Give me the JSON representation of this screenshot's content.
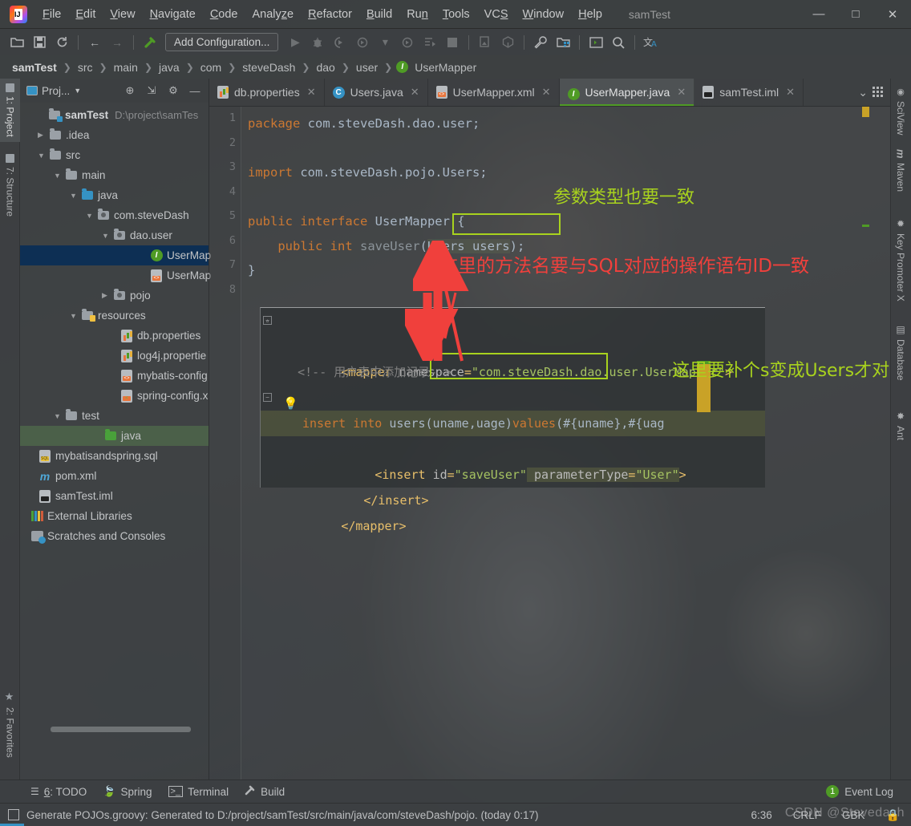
{
  "window": {
    "title": "samTest",
    "minimize": "—",
    "maximize": "□",
    "close": "✕"
  },
  "menubar": {
    "items": [
      {
        "label": "File",
        "mnemonic": "F"
      },
      {
        "label": "Edit",
        "mnemonic": "E"
      },
      {
        "label": "View",
        "mnemonic": "V"
      },
      {
        "label": "Navigate",
        "mnemonic": "N"
      },
      {
        "label": "Code",
        "mnemonic": "C"
      },
      {
        "label": "Analyze",
        "mnemonic": "z"
      },
      {
        "label": "Refactor",
        "mnemonic": "R"
      },
      {
        "label": "Build",
        "mnemonic": "B"
      },
      {
        "label": "Run",
        "mnemonic": "n"
      },
      {
        "label": "Tools",
        "mnemonic": "T"
      },
      {
        "label": "VCS",
        "mnemonic": "S"
      },
      {
        "label": "Window",
        "mnemonic": "W"
      },
      {
        "label": "Help",
        "mnemonic": "H"
      }
    ]
  },
  "toolbar": {
    "run_config_label": "Add Configuration...",
    "icons": [
      "open-folder-icon",
      "save-all-icon",
      "sync-icon",
      "back-icon",
      "forward-icon",
      "build-hammer-icon",
      "run-icon",
      "debug-icon",
      "run-with-coverage-icon",
      "profile-icon",
      "profile-dropdown-icon",
      "rerun-icon",
      "run-console-icon",
      "stop-icon",
      "update-project-icon",
      "commit-icon",
      "settings-wrench-icon",
      "project-structure-icon",
      "terminal-icon",
      "search-everywhere-icon",
      "translate-icon"
    ]
  },
  "breadcrumb": {
    "items": [
      "samTest",
      "src",
      "main",
      "java",
      "com",
      "steveDash",
      "dao",
      "user"
    ],
    "leaf": "UserMapper",
    "leaf_icon": "I"
  },
  "left_tool_strip": {
    "tabs": [
      {
        "label": "1: Project",
        "active": true,
        "icon": "project-folder-icon"
      },
      {
        "label": "7: Structure",
        "active": false,
        "icon": "structure-icon"
      },
      {
        "label": "2: Favorites",
        "active": false,
        "icon": "star-icon"
      }
    ]
  },
  "right_tool_strip": {
    "tabs": [
      {
        "label": "SciView",
        "icon": "sciview-icon"
      },
      {
        "label": "Maven",
        "icon": "maven-m-icon"
      },
      {
        "label": "Key Promoter X",
        "icon": "key-promoter-icon"
      },
      {
        "label": "Database",
        "icon": "database-icon"
      },
      {
        "label": "Ant",
        "icon": "ant-icon"
      }
    ]
  },
  "project_panel": {
    "title": "Proj...",
    "header_icons": [
      "target-locate-icon",
      "collapse-all-icon",
      "gear-icon",
      "hide-icon"
    ],
    "tree": [
      {
        "label": "samTest",
        "path": "D:\\project\\samTes",
        "depth": 0,
        "arrow": "",
        "icon": "module-folder-icon",
        "bold": true,
        "state": "none"
      },
      {
        "label": ".idea",
        "depth": 1,
        "arrow": "▶",
        "icon": "folder-icon",
        "state": "none"
      },
      {
        "label": "src",
        "depth": 1,
        "arrow": "▼",
        "icon": "folder-icon",
        "state": "none"
      },
      {
        "label": "main",
        "depth": 2,
        "arrow": "▼",
        "icon": "folder-icon",
        "state": "none"
      },
      {
        "label": "java",
        "depth": 3,
        "arrow": "▼",
        "icon": "source-root-folder-icon",
        "state": "none"
      },
      {
        "label": "com.steveDash",
        "depth": 4,
        "arrow": "▼",
        "icon": "package-icon",
        "state": "none"
      },
      {
        "label": "dao.user",
        "depth": 5,
        "arrow": "▼",
        "icon": "package-icon",
        "state": "none"
      },
      {
        "label": "UserMap",
        "depth": 6,
        "arrow": "",
        "icon": "interface-icon",
        "state": "selected-blue"
      },
      {
        "label": "UserMap",
        "depth": 6,
        "arrow": "",
        "icon": "xml-file-icon",
        "state": "none"
      },
      {
        "label": "pojo",
        "depth": 4,
        "arrow": "▶",
        "icon": "package-icon",
        "state": "none"
      },
      {
        "label": "resources",
        "depth": 3,
        "arrow": "▼",
        "icon": "resources-folder-icon",
        "state": "none"
      },
      {
        "label": "db.properties",
        "depth": 4,
        "arrow": "",
        "icon": "properties-file-icon",
        "state": "none"
      },
      {
        "label": "log4j.propertie",
        "depth": 4,
        "arrow": "",
        "icon": "properties-file-icon",
        "state": "none"
      },
      {
        "label": "mybatis-config",
        "depth": 4,
        "arrow": "",
        "icon": "xml-file-icon",
        "state": "none"
      },
      {
        "label": "spring-config.x",
        "depth": 4,
        "arrow": "",
        "icon": "spring-xml-file-icon",
        "state": "none"
      },
      {
        "label": "test",
        "depth": 2,
        "arrow": "▼",
        "icon": "folder-icon",
        "state": "none"
      },
      {
        "label": "java",
        "depth": 3,
        "arrow": "",
        "icon": "test-source-root-icon",
        "state": "selected-green"
      },
      {
        "label": "mybatisandspring.sql",
        "depth": 1,
        "arrow": "",
        "icon": "sql-file-icon",
        "state": "none"
      },
      {
        "label": "pom.xml",
        "depth": 1,
        "arrow": "",
        "icon": "maven-pom-icon",
        "state": "none"
      },
      {
        "label": "samTest.iml",
        "depth": 1,
        "arrow": "",
        "icon": "iml-file-icon",
        "state": "none"
      },
      {
        "label": "External Libraries",
        "depth": 0,
        "arrow": "",
        "icon": "libraries-icon",
        "state": "none"
      },
      {
        "label": "Scratches and Consoles",
        "depth": 0,
        "arrow": "",
        "icon": "scratches-icon",
        "state": "none"
      }
    ]
  },
  "editor_tabs": [
    {
      "label": "db.properties",
      "icon": "properties-file-icon",
      "active": false,
      "closable": true
    },
    {
      "label": "Users.java",
      "icon": "class-icon",
      "active": false,
      "closable": true
    },
    {
      "label": "UserMapper.xml",
      "icon": "xml-file-icon",
      "active": false,
      "closable": true
    },
    {
      "label": "UserMapper.java",
      "icon": "interface-icon",
      "active": true,
      "closable": true
    },
    {
      "label": "samTest.iml",
      "icon": "iml-file-icon",
      "active": false,
      "closable": true
    }
  ],
  "editor_tabs_overflow_icon": "chevron-down-icon",
  "java_editor": {
    "line_numbers": [
      "1",
      "2",
      "3",
      "4",
      "5",
      "6",
      "7",
      "8"
    ],
    "lines": [
      [
        {
          "t": "package ",
          "c": "kw"
        },
        {
          "t": "com.steveDash.dao.user;",
          "c": "pln"
        }
      ],
      [],
      [
        {
          "t": "import ",
          "c": "kw"
        },
        {
          "t": "com.steveDash.pojo.Users;",
          "c": "pln"
        }
      ],
      [],
      [
        {
          "t": "public interface ",
          "c": "kw"
        },
        {
          "t": "UserMapper {",
          "c": "pln"
        }
      ],
      [
        {
          "t": "    public int ",
          "c": "kw"
        },
        {
          "t": "saveUser",
          "c": "mth"
        },
        {
          "t": "(Users users);",
          "c": "pln"
        }
      ],
      [
        {
          "t": "}",
          "c": "pln"
        }
      ],
      []
    ]
  },
  "xml_editor": {
    "lines": [
      "<mapper namespace=\"com.steveDash.dao.user.UserMapper\">",
      "",
      "    <!-- 用户表中添加记录-->",
      "    <insert id=\"saveUser\" parameterType=\"User\">",
      "        insert into users(uname,uage)values(#{uname},#{uag",
      "    </insert>",
      "</mapper>"
    ],
    "comment_text": "用户表中添加记录",
    "mapper_namespace": "com.steveDash.dao.user.UserMapper",
    "insert_id": "saveUser",
    "parameter_type": "User",
    "sql_statement": "insert into users(uname,uage)values(#{uname},#{uag"
  },
  "annotations": [
    {
      "id": "param-type-note",
      "text": "参数类型也要一致",
      "color": "#a8d21e",
      "kind": "green-note"
    },
    {
      "id": "method-name-note",
      "text": "这里的方法名要与SQL对应的操作语句ID一致",
      "color": "#f0403c",
      "kind": "red-note"
    },
    {
      "id": "add-s-note",
      "text": "这里要补个s变成Users才对",
      "color": "#a8d21e",
      "kind": "green-note"
    }
  ],
  "highlight_boxes": [
    {
      "id": "users-users-box",
      "color": "#a8d21e"
    },
    {
      "id": "parameter-type-box",
      "color": "#a8d21e"
    }
  ],
  "bottom_tool_window_bar": {
    "items": [
      {
        "label": "6: TODO",
        "mnemonic": "6",
        "icon": "todo-list-icon"
      },
      {
        "label": "Spring",
        "icon": "spring-leaf-icon"
      },
      {
        "label": "Terminal",
        "icon": "terminal-icon"
      },
      {
        "label": "Build",
        "icon": "build-hammer-icon"
      }
    ],
    "event_log": {
      "label": "Event Log",
      "badge": "1"
    }
  },
  "status_bar": {
    "message": "Generate POJOs.groovy: Generated to D:/project/samTest/src/main/java/com/steveDash/pojo. (today 0:17)",
    "caret_position": "6:36",
    "line_separator": "CRLF",
    "encoding": "GBK",
    "watermark": "CSDN @Stevedash",
    "lock_icon": "lock-icon"
  },
  "colors": {
    "accent_green": "#a8d21e",
    "annotation_red": "#f0403c",
    "selection_blue": "#0d2f54",
    "interface_green": "#4f9b25",
    "keyword_orange": "#cc7832",
    "string_green": "#a5c261",
    "xml_tag_yellow": "#e8bf6a"
  }
}
